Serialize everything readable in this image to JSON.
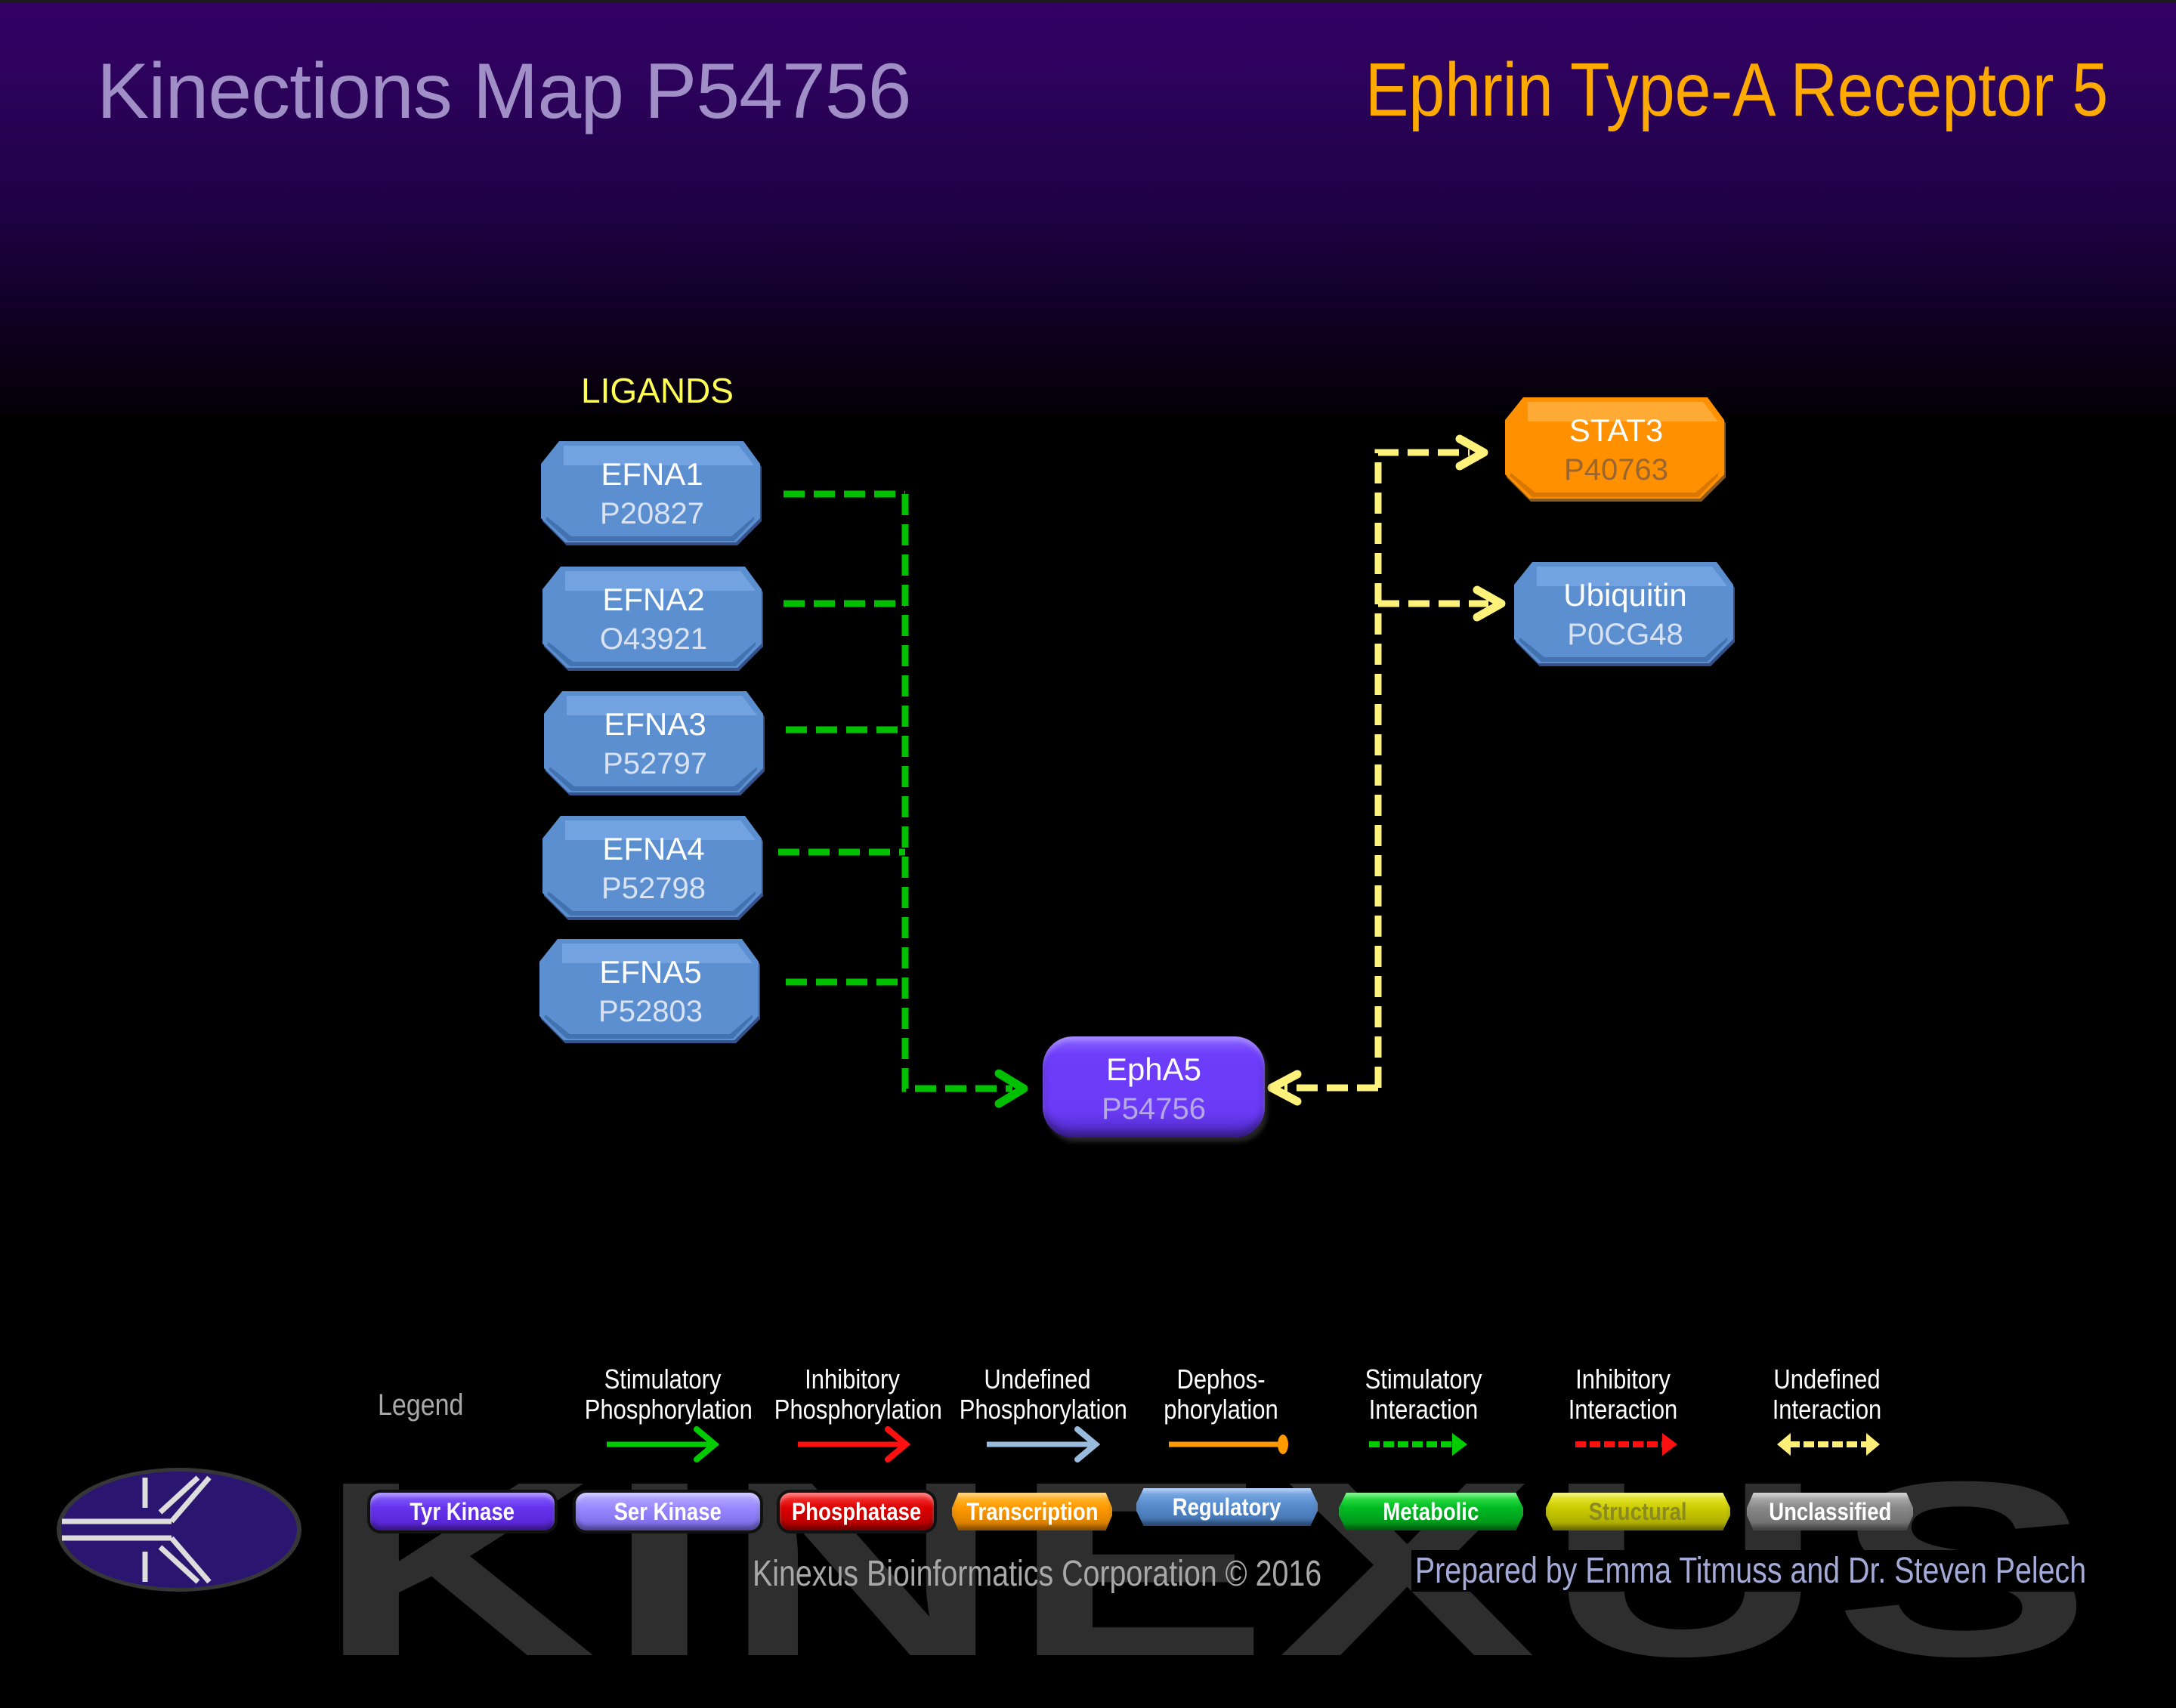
{
  "header": {
    "title": "Kinections Map P54756",
    "protein_name": "Ephrin Type-A Receptor 5"
  },
  "section_label": "LIGANDS",
  "nodes": {
    "efna1": {
      "name": "EFNA1",
      "accession": "P20827",
      "category": "Regulatory"
    },
    "efna2": {
      "name": "EFNA2",
      "accession": "O43921",
      "category": "Regulatory"
    },
    "efna3": {
      "name": "EFNA3",
      "accession": "P52797",
      "category": "Regulatory"
    },
    "efna4": {
      "name": "EFNA4",
      "accession": "P52798",
      "category": "Regulatory"
    },
    "efna5": {
      "name": "EFNA5",
      "accession": "P52803",
      "category": "Regulatory"
    },
    "stat3": {
      "name": "STAT3",
      "accession": "P40763",
      "category": "Transcription"
    },
    "ubiquitin": {
      "name": "Ubiquitin",
      "accession": "P0CG48",
      "category": "Regulatory"
    },
    "epha5": {
      "name": "EphA5",
      "accession": "P54756",
      "category": "Tyr Kinase"
    }
  },
  "edges": [
    {
      "from": "EFNA1",
      "to": "EphA5",
      "type": "Stimulatory Interaction"
    },
    {
      "from": "EFNA2",
      "to": "EphA5",
      "type": "Stimulatory Interaction"
    },
    {
      "from": "EFNA3",
      "to": "EphA5",
      "type": "Stimulatory Interaction"
    },
    {
      "from": "EFNA4",
      "to": "EphA5",
      "type": "Stimulatory Interaction"
    },
    {
      "from": "EFNA5",
      "to": "EphA5",
      "type": "Stimulatory Interaction"
    },
    {
      "from": "EphA5",
      "to": "STAT3",
      "type": "Undefined Interaction"
    },
    {
      "from": "EphA5",
      "to": "Ubiquitin",
      "type": "Undefined Interaction"
    }
  ],
  "legend": {
    "title": "Legend",
    "edge_types": [
      {
        "line1": "Stimulatory",
        "line2": "Phosphorylation",
        "color": "#00cc00"
      },
      {
        "line1": "Inhibitory",
        "line2": "Phosphorylation",
        "color": "#ff0000"
      },
      {
        "line1": "Undefined",
        "line2": "Phosphorylation",
        "color": "#99bbdd"
      },
      {
        "line1": "Dephos-",
        "line2": "phorylation",
        "color": "#ff9900"
      },
      {
        "line1": "Stimulatory",
        "line2": "Interaction",
        "color": "#00cc00"
      },
      {
        "line1": "Inhibitory",
        "line2": "Interaction",
        "color": "#ff0000"
      },
      {
        "line1": "Undefined",
        "line2": "Interaction",
        "color": "#ffee77"
      }
    ],
    "node_types": [
      {
        "label": "Tyr Kinase",
        "color": "#6633ff"
      },
      {
        "label": "Ser Kinase",
        "color": "#9988ff"
      },
      {
        "label": "Phosphatase",
        "color": "#dd0000"
      },
      {
        "label": "Transcription",
        "color": "#ff9900"
      },
      {
        "label": "Regulatory",
        "color": "#5b8fd0"
      },
      {
        "label": "Metabolic",
        "color": "#00bb22"
      },
      {
        "label": "Structural",
        "color": "#cccc00"
      },
      {
        "label": "Unclassified",
        "color": "#888888"
      }
    ]
  },
  "watermark": "KINEXUS",
  "footer": {
    "copyright": "Kinexus Bioinformatics Corporation © 2016",
    "prepared_by": "Prepared by Emma Titmuss and Dr. Steven Pelech"
  },
  "colors": {
    "regulatory": "#5b8fd0",
    "transcription": "#ff9000",
    "tyr_kinase": "#6a3af5",
    "stimulatory": "#00c000",
    "undefined": "#ffee77"
  }
}
